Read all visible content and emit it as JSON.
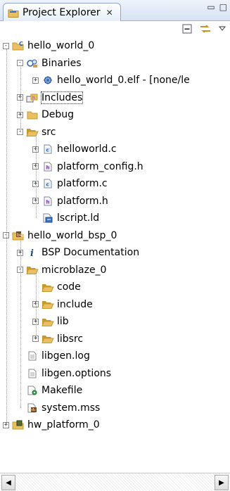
{
  "view": {
    "title": "Project Explorer",
    "close_glyph": "✕"
  },
  "tree": [
    {
      "label": "hello_world_0",
      "icon": "c-project-icon",
      "exp": "-",
      "level": 0
    },
    {
      "label": "Binaries",
      "icon": "binaries-icon",
      "exp": "-",
      "level": 1
    },
    {
      "label": "hello_world_0.elf - [none/le",
      "icon": "elf-binary-icon",
      "exp": "+",
      "level": 2
    },
    {
      "label": "Includes",
      "icon": "includes-icon",
      "exp": "+",
      "level": 1,
      "selected": true
    },
    {
      "label": "Debug",
      "icon": "folder-icon",
      "exp": "+",
      "level": 1
    },
    {
      "label": "src",
      "icon": "folder-open-icon",
      "exp": "-",
      "level": 1
    },
    {
      "label": "helloworld.c",
      "icon": "c-file-icon",
      "exp": "+",
      "level": 2
    },
    {
      "label": "platform_config.h",
      "icon": "h-file-icon",
      "exp": "+",
      "level": 2
    },
    {
      "label": "platform.c",
      "icon": "c-file-icon",
      "exp": "+",
      "level": 2
    },
    {
      "label": "platform.h",
      "icon": "h-file-icon",
      "exp": "+",
      "level": 2
    },
    {
      "label": "lscript.ld",
      "icon": "linker-script-icon",
      "exp": "",
      "level": 2
    },
    {
      "label": "hello_world_bsp_0",
      "icon": "bsp-project-icon",
      "exp": "-",
      "level": 0
    },
    {
      "label": "BSP Documentation",
      "icon": "info-icon",
      "exp": "+",
      "level": 1
    },
    {
      "label": "microblaze_0",
      "icon": "folder-open-icon",
      "exp": "-",
      "level": 1
    },
    {
      "label": "code",
      "icon": "folder-open-icon",
      "exp": "",
      "level": 2
    },
    {
      "label": "include",
      "icon": "folder-open-icon",
      "exp": "+",
      "level": 2
    },
    {
      "label": "lib",
      "icon": "folder-open-icon",
      "exp": "+",
      "level": 2
    },
    {
      "label": "libsrc",
      "icon": "folder-open-icon",
      "exp": "+",
      "level": 2
    },
    {
      "label": "libgen.log",
      "icon": "text-file-icon",
      "exp": "",
      "level": 1
    },
    {
      "label": "libgen.options",
      "icon": "text-file-icon",
      "exp": "",
      "level": 1
    },
    {
      "label": "Makefile",
      "icon": "makefile-icon",
      "exp": "",
      "level": 1
    },
    {
      "label": "system.mss",
      "icon": "mss-file-icon",
      "exp": "",
      "level": 1
    },
    {
      "label": "hw_platform_0",
      "icon": "hw-platform-icon",
      "exp": "+",
      "level": 0
    }
  ],
  "colors": {
    "folder": "#e8c063",
    "folder_dark": "#c99a2b",
    "c_blue": "#2c5fb3",
    "h_purple": "#7a3fb0"
  }
}
